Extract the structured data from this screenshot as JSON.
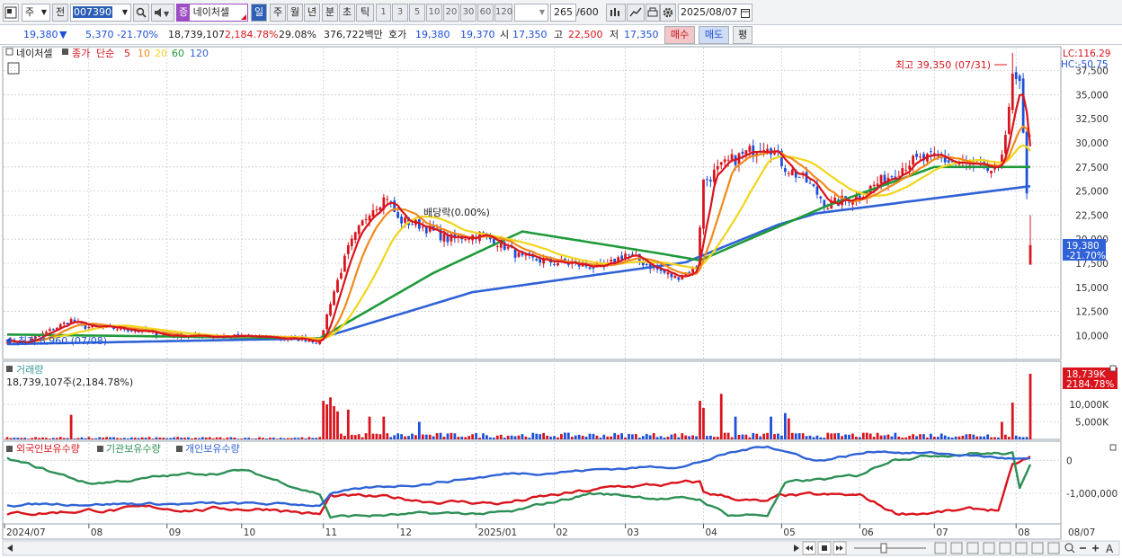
{
  "toolbar": {
    "market": "주",
    "prev_label": "전",
    "code": "007390",
    "sector_badge": "증",
    "stock_name": "네이처셀",
    "periods": [
      "일",
      "주",
      "월",
      "년",
      "분",
      "초",
      "틱"
    ],
    "intervals": [
      "1",
      "3",
      "5",
      "10",
      "20",
      "30",
      "60",
      "120"
    ],
    "count": "265",
    "count_total": "/600",
    "date": "2025/08/07"
  },
  "quote": {
    "price": "19,380",
    "change": "5,370",
    "change_pct": "-21.70%",
    "volume": "18,739,107",
    "volume_pct": "2,184.78%",
    "turnover_pct": "29.08%",
    "amount": "376,722백만",
    "ask_label": "호가",
    "ask": "19,380",
    "bid": "19,370",
    "open_label": "시",
    "open": "17,350",
    "high_label": "고",
    "high": "22,500",
    "low_label": "저",
    "low": "17,350",
    "buy_label": "매수",
    "sell_label": "매도",
    "eval_label": "평"
  },
  "colors": {
    "up": "#d9141c",
    "down": "#1d4fd8",
    "ma5": "#d9141c",
    "ma10": "#f08a1c",
    "ma20": "#f2d51a",
    "ma60": "#1f9a3a",
    "ma120": "#2f62d6",
    "foreign": "#2f62d6",
    "institution": "#d9141c",
    "individual": "#2d8f55"
  },
  "chart_data": [
    {
      "type": "candlestick",
      "legend": {
        "name": "네이처셀",
        "close_label": "종가",
        "simple_label": "단순",
        "ma_periods": [
          "5",
          "10",
          "20",
          "60",
          "120"
        ]
      },
      "lc_label": "LC:116.29",
      "hc_label": "HC:-50.75",
      "high_annotation": "최고 39,350 (07/31)",
      "low_annotation": "최저 8,960 (07/08)",
      "ex_dividend_label": "배당락(0.00%)",
      "y_ticks": [
        "37,500",
        "35,000",
        "32,500",
        "30,000",
        "27,500",
        "25,000",
        "22,500",
        "20,000",
        "17,500",
        "15,000",
        "12,500",
        "10,000"
      ],
      "ylim": [
        7700,
        39800
      ],
      "last_price_label": "19,380",
      "last_change_label": "-21.70%",
      "x_tick_labels": [
        "2024/07",
        "08",
        "09",
        "10",
        "11",
        "12",
        "2025/01",
        "02",
        "03",
        "04",
        "05",
        "06",
        "07",
        "08"
      ],
      "x_axis_end_label": "08/07",
      "price_anchors": [
        [
          "2024-07-01",
          9500
        ],
        [
          "2024-07-08",
          9200
        ],
        [
          "2024-07-25",
          11600
        ],
        [
          "2024-07-31",
          10900
        ],
        [
          "2024-08-15",
          10700
        ],
        [
          "2024-09-01",
          10000
        ],
        [
          "2024-09-30",
          9900
        ],
        [
          "2024-10-25",
          9600
        ],
        [
          "2024-10-31",
          9300
        ],
        [
          "2024-11-05",
          13500
        ],
        [
          "2024-11-12",
          19000
        ],
        [
          "2024-11-20",
          23000
        ],
        [
          "2024-11-27",
          24500
        ],
        [
          "2024-12-02",
          22000
        ],
        [
          "2024-12-10",
          21500
        ],
        [
          "2024-12-20",
          20000
        ],
        [
          "2025-01-02",
          20500
        ],
        [
          "2025-01-10",
          19500
        ],
        [
          "2025-01-20",
          18000
        ],
        [
          "2025-02-05",
          17500
        ],
        [
          "2025-02-20",
          17000
        ],
        [
          "2025-03-01",
          18500
        ],
        [
          "2025-03-12",
          17000
        ],
        [
          "2025-03-20",
          16000
        ],
        [
          "2025-03-28",
          17000
        ],
        [
          "2025-04-01",
          26000
        ],
        [
          "2025-04-10",
          28000
        ],
        [
          "2025-04-25",
          30000
        ],
        [
          "2025-05-02",
          27500
        ],
        [
          "2025-05-12",
          26000
        ],
        [
          "2025-05-20",
          23500
        ],
        [
          "2025-05-30",
          24500
        ],
        [
          "2025-06-10",
          26000
        ],
        [
          "2025-06-20",
          28000
        ],
        [
          "2025-07-01",
          28500
        ],
        [
          "2025-07-15",
          27500
        ],
        [
          "2025-07-25",
          27000
        ],
        [
          "2025-07-28",
          29000
        ],
        [
          "2025-07-31",
          36500
        ],
        [
          "2025-08-04",
          36000
        ],
        [
          "2025-08-06",
          24750
        ],
        [
          "2025-08-07",
          19380
        ]
      ],
      "ma_anchors": {
        "ma60": [
          [
            "2024-07-01",
            10100
          ],
          [
            "2024-10-31",
            9700
          ],
          [
            "2024-12-15",
            16500
          ],
          [
            "2025-01-20",
            20800
          ],
          [
            "2025-03-15",
            18500
          ],
          [
            "2025-03-31",
            17800
          ],
          [
            "2025-05-20",
            23500
          ],
          [
            "2025-07-01",
            27500
          ],
          [
            "2025-08-07",
            27500
          ]
        ],
        "ma120": [
          [
            "2024-07-01",
            9100
          ],
          [
            "2024-10-31",
            9700
          ],
          [
            "2024-12-31",
            14500
          ],
          [
            "2025-03-25",
            17600
          ],
          [
            "2025-04-30",
            21500
          ],
          [
            "2025-05-15",
            22700
          ],
          [
            "2025-08-07",
            25500
          ]
        ]
      }
    },
    {
      "type": "bar",
      "title": "거래량",
      "value_label": "18,739,107주(2,184.78%)",
      "y_ticks": [
        "10,000K",
        "5,000K"
      ],
      "last_label": "18,739K",
      "last_pct_label": "2184.78%",
      "spikes": [
        [
          "2024-07-25",
          7000
        ],
        [
          "2024-11-01",
          11000
        ],
        [
          "2024-11-04",
          10000
        ],
        [
          "2024-11-05",
          12000
        ],
        [
          "2024-11-06",
          9500
        ],
        [
          "2024-11-07",
          8000
        ],
        [
          "2024-11-12",
          8500
        ],
        [
          "2024-11-20",
          6500
        ],
        [
          "2024-11-26",
          6500
        ],
        [
          "2024-12-10",
          5000
        ],
        [
          "2025-03-31",
          11000
        ],
        [
          "2025-04-01",
          9000
        ],
        [
          "2025-04-08",
          13000
        ],
        [
          "2025-04-14",
          6500
        ],
        [
          "2025-04-28",
          6500
        ],
        [
          "2025-05-02",
          7500
        ],
        [
          "2025-05-05",
          6000
        ],
        [
          "2025-07-28",
          5000
        ],
        [
          "2025-07-31",
          10500
        ],
        [
          "2025-08-07",
          18739
        ]
      ],
      "ylim": [
        0,
        20000
      ]
    },
    {
      "type": "line",
      "series": [
        {
          "name": "외국인보유수량"
        },
        {
          "name": "기관보유수량"
        },
        {
          "name": "개인보유수량"
        }
      ],
      "y_ticks": [
        "0",
        "-1,000,000"
      ],
      "ylim": [
        -1900000,
        500000
      ]
    }
  ]
}
